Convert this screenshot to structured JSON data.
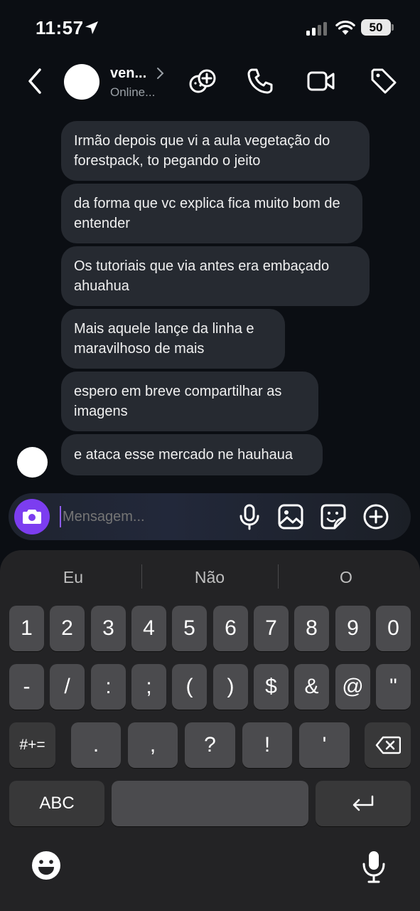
{
  "status_bar": {
    "time": "11:57",
    "battery": "50"
  },
  "header": {
    "name": "ven...",
    "status": "Online..."
  },
  "messages": [
    "Irmão depois que vi a aula vegetação do forestpack, to pegando o jeito",
    "da forma que vc explica fica muito bom de entender",
    "Os tutoriais que via antes era embaçado ahuahua",
    "Mais aquele lançe da linha e maravilhoso de mais",
    "espero em breve compartilhar as imagens",
    "e ataca esse mercado ne hauhaua"
  ],
  "composer": {
    "placeholder": "Mensagem..."
  },
  "keyboard": {
    "suggestions": [
      "Eu",
      "Não",
      "O"
    ],
    "row1": [
      "1",
      "2",
      "3",
      "4",
      "5",
      "6",
      "7",
      "8",
      "9",
      "0"
    ],
    "row2": [
      "-",
      "/",
      ":",
      ";",
      "(",
      ")",
      "$",
      "&",
      "@",
      "\""
    ],
    "row3": [
      "#+=",
      ".",
      ",",
      "?",
      "!",
      "'"
    ],
    "abc": "ABC"
  }
}
